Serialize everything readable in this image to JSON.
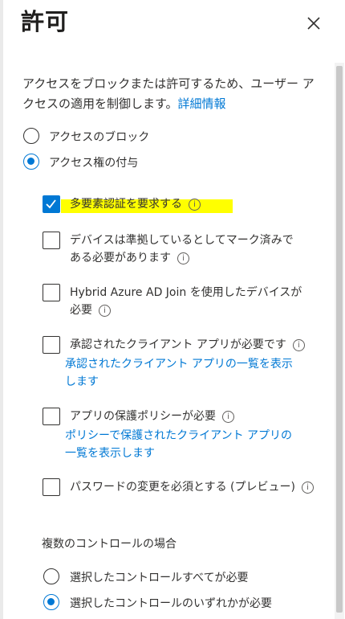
{
  "panel": {
    "title": "許可"
  },
  "description": {
    "text": "アクセスをブロックまたは許可するため、ユーザー アクセスの適用を制御します。",
    "link": "詳細情報"
  },
  "access_options": [
    {
      "label": "アクセスのブロック",
      "selected": false
    },
    {
      "label": "アクセス権の付与",
      "selected": true
    }
  ],
  "controls": [
    {
      "label": "多要素認証を要求する",
      "checked": true,
      "highlighted": true
    },
    {
      "label": "デバイスは準拠しているとしてマーク済みである必要があります",
      "checked": false
    },
    {
      "label": "Hybrid Azure AD Join を使用したデバイスが必要",
      "checked": false
    },
    {
      "label": "承認されたクライアント アプリが必要です",
      "checked": false,
      "link": "承認されたクライアント アプリの一覧を表示します"
    },
    {
      "label": "アプリの保護ポリシーが必要",
      "checked": false,
      "link": "ポリシーで保護されたクライアント アプリの一覧を表示します"
    },
    {
      "label": "パスワードの変更を必須とする (プレビュー)",
      "checked": false
    }
  ],
  "multi_controls": {
    "label": "複数のコントロールの場合",
    "options": [
      {
        "label": "選択したコントロールすべてが必要",
        "selected": false
      },
      {
        "label": "選択したコントロールのいずれかが必要",
        "selected": true
      }
    ]
  },
  "info_icon_glyph": "i",
  "colors": {
    "accent": "#0078d4",
    "highlight": "#ffff00"
  }
}
